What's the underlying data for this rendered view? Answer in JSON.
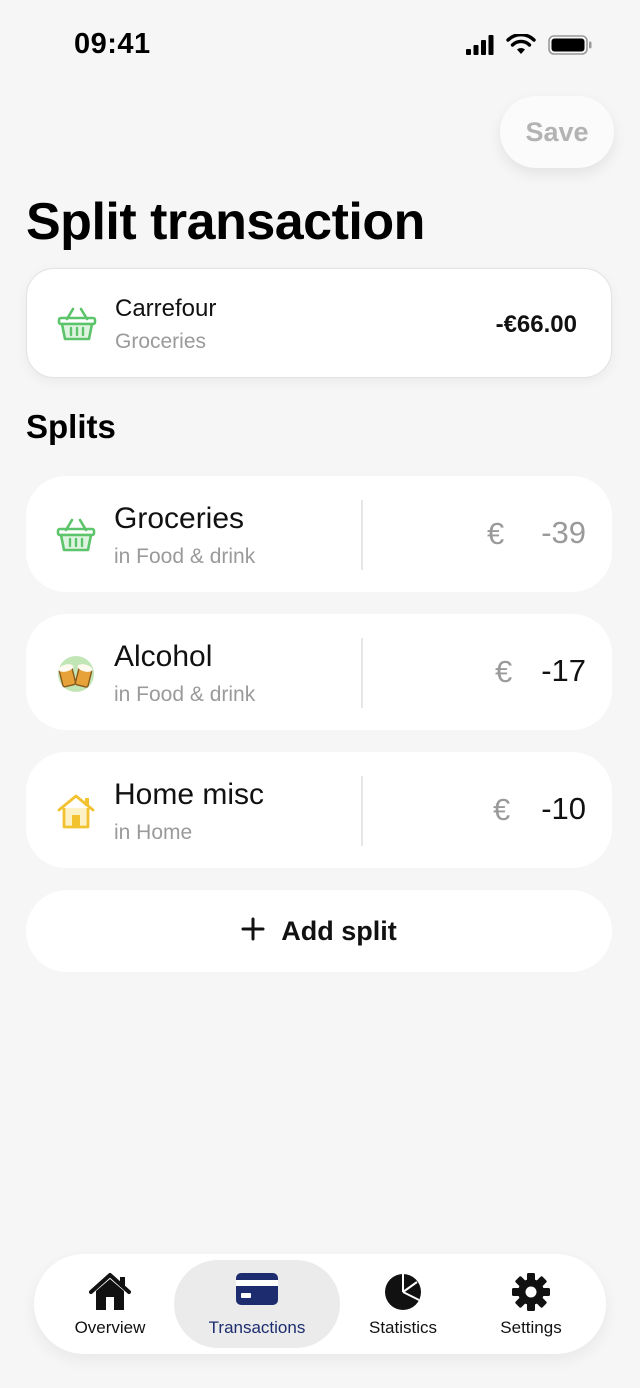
{
  "status_bar": {
    "time": "09:41",
    "icons": [
      "signal-icon",
      "wifi-icon",
      "battery-icon"
    ]
  },
  "header": {
    "save_label": "Save",
    "title": "Split transaction"
  },
  "transaction": {
    "name": "Carrefour",
    "category": "Groceries",
    "amount": "-€66.00",
    "icon": "basket-icon"
  },
  "splits_section": {
    "title": "Splits"
  },
  "splits": [
    {
      "name": "Groceries",
      "subtitle": "in Food & drink",
      "currency": "€",
      "value": "-39",
      "icon": "basket-icon",
      "value_color": "#9a9a9a"
    },
    {
      "name": "Alcohol",
      "subtitle": "in Food & drink",
      "currency": "€",
      "value": "-17",
      "icon": "beer-mugs-icon",
      "value_color": "#111111"
    },
    {
      "name": "Home misc",
      "subtitle": "in Home",
      "currency": "€",
      "value": "-10",
      "icon": "house-icon",
      "value_color": "#111111"
    }
  ],
  "add_split": {
    "label": "Add split"
  },
  "tab_bar": {
    "tabs": [
      {
        "label": "Overview",
        "icon": "home-icon"
      },
      {
        "label": "Transactions",
        "icon": "card-icon",
        "active": true
      },
      {
        "label": "Statistics",
        "icon": "pie-chart-icon"
      },
      {
        "label": "Settings",
        "icon": "gear-icon"
      }
    ]
  },
  "colors": {
    "background": "#f6f6f6",
    "accent_navy": "#1c2c6e",
    "basket_green": "#5cc46a",
    "house_yellow": "#f2c230",
    "muted_text": "#9a9a9a"
  }
}
